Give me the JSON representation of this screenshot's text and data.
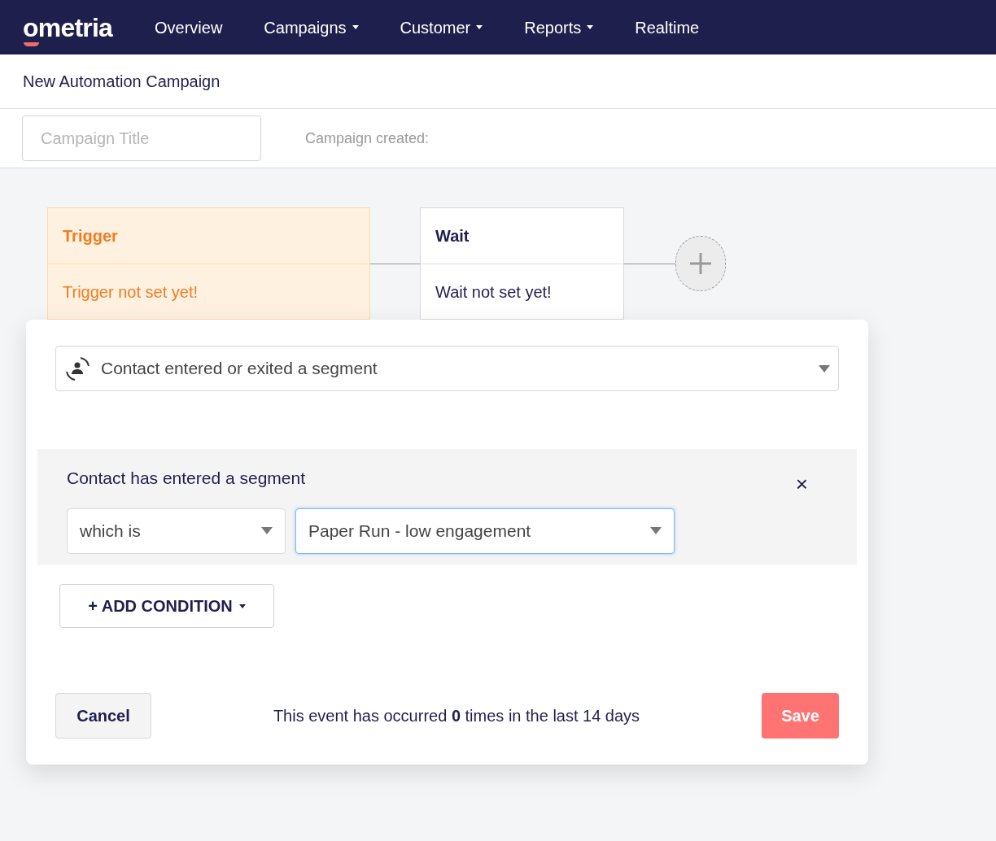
{
  "nav": {
    "logo": "ometria",
    "items": [
      {
        "label": "Overview",
        "dropdown": false
      },
      {
        "label": "Campaigns",
        "dropdown": true
      },
      {
        "label": "Customer",
        "dropdown": true
      },
      {
        "label": "Reports",
        "dropdown": true
      },
      {
        "label": "Realtime",
        "dropdown": false
      }
    ]
  },
  "page_title": "New Automation Campaign",
  "campaign_title": {
    "placeholder": "Campaign Title"
  },
  "campaign_created": "Campaign created:",
  "nodes": [
    {
      "title": "Trigger",
      "status": "Trigger not set yet!",
      "selected": true
    },
    {
      "title": "Wait",
      "status": "Wait not set yet!",
      "selected": false
    }
  ],
  "panel": {
    "event": "Contact entered or exited a segment",
    "condition": {
      "title": "Contact has entered a segment",
      "operator": "which is",
      "value": "Paper Run - low engagement",
      "close": "×"
    },
    "add_condition": "+ ADD CONDITION",
    "cancel": "Cancel",
    "summary": "This event has occurred **0** times in the last 14 days",
    "save": "Save"
  }
}
